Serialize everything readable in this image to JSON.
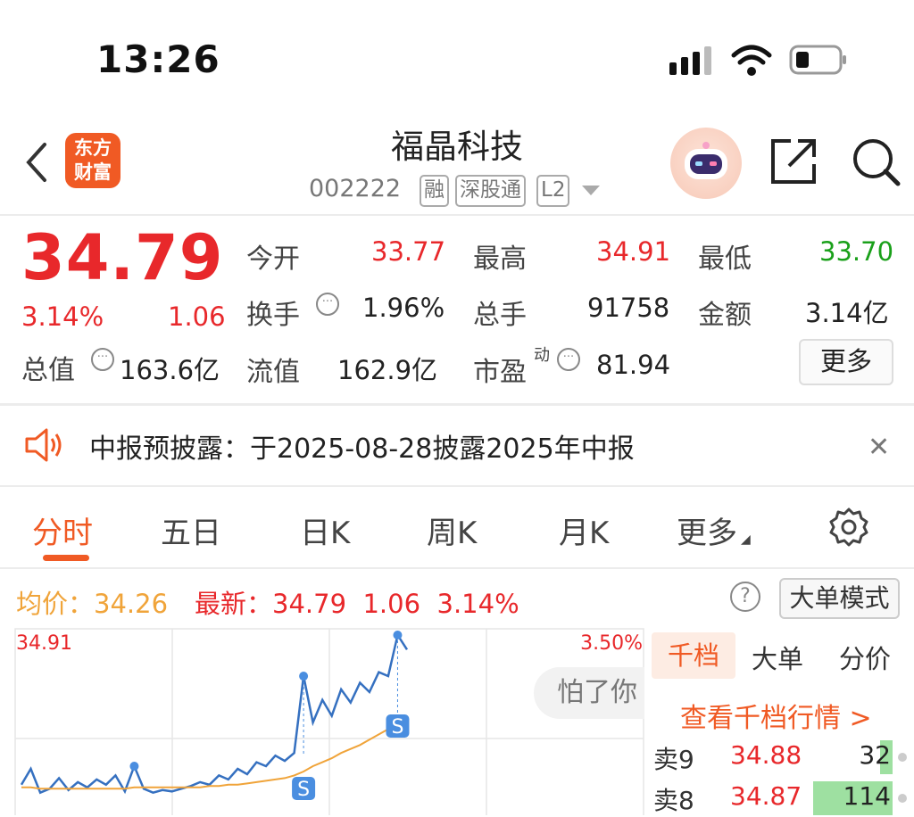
{
  "status_bar": {
    "time": "13:26"
  },
  "header": {
    "logo_text_line1": "东方",
    "logo_text_line2": "财富",
    "stock_name": "福晶科技",
    "stock_code": "002222",
    "tags": [
      "融",
      "深股通",
      "L2"
    ],
    "icons": [
      "back-chevron-icon",
      "robot-assistant-icon",
      "share-icon",
      "search-icon"
    ]
  },
  "quote": {
    "price": "34.79",
    "change_pct": "3.14%",
    "change": "1.06",
    "open_label": "今开",
    "open": "33.77",
    "high_label": "最高",
    "high": "34.91",
    "low_label": "最低",
    "low": "33.70",
    "turnover_label": "换手",
    "turnover": "1.96%",
    "volume_label": "总手",
    "volume": "91758",
    "amount_label": "金额",
    "amount": "3.14亿",
    "market_cap_label": "总值",
    "market_cap": "163.6亿",
    "float_cap_label": "流值",
    "float_cap": "162.9亿",
    "pe_label": "市盈",
    "pe_sup": "动",
    "pe": "81.94",
    "more_label": "更多"
  },
  "notice": {
    "text": "中报预披露：于2025-08-28披露2025年中报"
  },
  "tabs": {
    "items": [
      "分时",
      "五日",
      "日K",
      "周K",
      "月K",
      "更多"
    ],
    "active": 0
  },
  "chart_header": {
    "avg_label": "均价：",
    "avg_value": "34.26",
    "latest_label": "最新：",
    "latest_value": "34.79",
    "latest_change": "1.06",
    "latest_pct": "3.14%",
    "mode_button": "大单模式"
  },
  "colors": {
    "up": "#e8282b",
    "down": "#1aa01a",
    "accent": "#f05a24",
    "avg_line": "#f0a43a",
    "price_line": "#3570c0"
  },
  "chart_data": {
    "type": "line",
    "y_max_label": "34.91",
    "y_max_pct_label": "3.50%",
    "series": [
      {
        "values": [
          33.78,
          33.9,
          33.72,
          33.75,
          33.83,
          33.74,
          33.8,
          33.76,
          33.82,
          33.78,
          33.85,
          33.73,
          33.92,
          33.75,
          33.72,
          33.74,
          33.73,
          33.75,
          33.77,
          33.8,
          33.78,
          33.85,
          33.82,
          33.9,
          33.86,
          33.95,
          33.92,
          34.0,
          33.96,
          34.02,
          34.6,
          34.25,
          34.42,
          34.3,
          34.5,
          34.4,
          34.55,
          34.48,
          34.63,
          34.6,
          34.91,
          34.8
        ]
      },
      {
        "values": [
          33.76,
          33.76,
          33.75,
          33.75,
          33.75,
          33.75,
          33.75,
          33.75,
          33.75,
          33.75,
          33.75,
          33.75,
          33.76,
          33.76,
          33.76,
          33.76,
          33.76,
          33.76,
          33.76,
          33.76,
          33.77,
          33.77,
          33.78,
          33.78,
          33.79,
          33.8,
          33.81,
          33.82,
          33.83,
          33.85,
          33.88,
          33.92,
          33.95,
          33.98,
          34.02,
          34.05,
          34.08,
          34.12,
          34.16,
          34.2,
          34.24,
          34.26
        ]
      }
    ],
    "ylim": [
      33.55,
      34.91
    ],
    "markers": [
      "S",
      "S"
    ],
    "bubble_text": "怕了你"
  },
  "orderbook": {
    "tabs": [
      "千档",
      "大单",
      "分价"
    ],
    "link": "查看千档行情 >",
    "rows": [
      {
        "label": "卖9",
        "price": "34.88",
        "vol": "32",
        "bar": 0.15
      },
      {
        "label": "卖8",
        "price": "34.87",
        "vol": "114",
        "bar": 0.95
      }
    ]
  }
}
